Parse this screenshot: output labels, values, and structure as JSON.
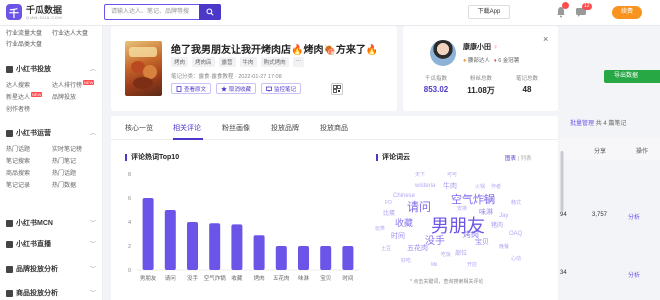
{
  "app": {
    "logo_char": "千",
    "name": "千瓜数据",
    "sub": "QIAN-GUA.COM"
  },
  "search": {
    "placeholder": "请输入达人、笔记、品牌等搜"
  },
  "header": {
    "download_app": "下载App",
    "message_count": "12",
    "renew": "续费"
  },
  "sidebar": {
    "quick_links": [
      "行业流量大盘",
      "行业达人大盘",
      "行业品类大盘"
    ],
    "sections": [
      {
        "title": "小红书投放",
        "items": [
          "达人搜索",
          "达人排行榜",
          "新星达人",
          "品牌投放",
          "创作者榜"
        ]
      },
      {
        "title": "小红书运营",
        "items": [
          "热门话题",
          "实时笔记榜",
          "笔记搜索",
          "热门笔记",
          "商品搜索",
          "热门话题",
          "笔记记录",
          "热门数据"
        ]
      },
      {
        "title": "小红书MCN"
      },
      {
        "title": "小红书直播"
      },
      {
        "title": "品牌投放分析"
      },
      {
        "title": "商品投放分析"
      }
    ],
    "badge_new": "NEW"
  },
  "background": {
    "green_button": "导出数据",
    "links_prefix": "批量管理",
    "links_suffix": "共 4 篇笔记",
    "table_headers": [
      "分享",
      "操作"
    ],
    "rows": [
      {
        "share": "3,757",
        "action": "分析"
      },
      {
        "share": "",
        "action": "分析"
      }
    ],
    "left_values": [
      "94",
      "34"
    ]
  },
  "note": {
    "title": "绝了我男朋友让我开烤肉店🔥烤肉🍖方来了🔥",
    "tags": [
      "烤肉",
      "烤肉店",
      "露营",
      "牛肉",
      "购式烤肉",
      "···"
    ],
    "time": "笔记分类：露食·露食教程 · 2022-01-27 17:08",
    "actions": [
      "查看原文",
      "取消收藏",
      "监控笔记"
    ]
  },
  "author": {
    "name": "康康小田",
    "gender_icon": "♀",
    "badges": [
      "腰部达人",
      "6 金冠薯"
    ],
    "stats": [
      {
        "label": "千瓜指数",
        "value": "853.02",
        "color": "#4b38c9"
      },
      {
        "label": "粉丝总数",
        "value": "11.08万",
        "color": "#222222"
      },
      {
        "label": "笔记总数",
        "value": "48",
        "color": "#222222"
      }
    ]
  },
  "tabs": [
    "核心一览",
    "相关评论",
    "粉丝画像",
    "投放品牌",
    "投放商品"
  ],
  "active_tab": 1,
  "chart_section_title": "评论热词Top10",
  "chart_data": {
    "type": "bar",
    "categories": [
      "男朋友",
      "请问",
      "没手",
      "空气炸锅",
      "收藏",
      "烤肉",
      "五花肉",
      "味淋",
      "宝贝",
      "时间"
    ],
    "values": [
      6.0,
      5.0,
      4.0,
      3.9,
      3.8,
      2.9,
      2.0,
      2.0,
      2.0,
      2.0
    ],
    "ylim": [
      0,
      6
    ],
    "yticks": [
      0,
      2,
      4,
      6,
      8
    ],
    "color": "#6a55e8"
  },
  "cloud": {
    "title": "评论词云",
    "toggle": [
      "图表",
      "列表"
    ],
    "note": "* 点击关键词，查询搜索相关评论",
    "words": [
      {
        "t": "男朋友",
        "c": "#6a55e8"
      },
      {
        "t": "请问",
        "c": "#7e6bec"
      },
      {
        "t": "空气炸锅",
        "c": "#7e6bec"
      },
      {
        "t": "没手",
        "c": "#8878ef"
      },
      {
        "t": "收藏",
        "c": "#8878ef"
      },
      {
        "t": "烤肉",
        "c": "#8878ef"
      },
      {
        "t": "五花肉",
        "c": "#9a8cf0"
      },
      {
        "t": "味淋",
        "c": "#9a8cf0"
      },
      {
        "t": "宝贝",
        "c": "#9a8cf0"
      },
      {
        "t": "时间",
        "c": "#9a8cf0"
      },
      {
        "t": "牛肉",
        "c": "#a99df2"
      },
      {
        "t": "猪肉",
        "c": "#a99df2"
      },
      {
        "t": "部位",
        "c": "#a99df2"
      },
      {
        "t": "比蛋",
        "c": "#a99df2"
      },
      {
        "t": "谢谢",
        "c": "#a99df2"
      },
      {
        "t": "Chinese",
        "c": "#b3a8f4"
      },
      {
        "t": "wisteria",
        "c": "#b3a8f4"
      },
      {
        "t": "Jay",
        "c": "#b3a8f4"
      },
      {
        "t": "OAQ",
        "c": "#b3a8f4"
      },
      {
        "t": "可可",
        "c": "#b3a8f4"
      },
      {
        "t": "天下",
        "c": "#b3a8f4"
      },
      {
        "t": "作者",
        "c": "#b3a8f4"
      },
      {
        "t": "Mii",
        "c": "#b3a8f4"
      },
      {
        "t": "开店",
        "c": "#b3a8f4"
      },
      {
        "t": "土豆",
        "c": "#b3a8f4"
      },
      {
        "t": "晚餐",
        "c": "#b3a8f4"
      },
      {
        "t": "好吃",
        "c": "#b3a8f4"
      },
      {
        "t": "玩笑",
        "c": "#b3a8f4"
      },
      {
        "t": "韩式",
        "c": "#b3a8f4"
      },
      {
        "t": "FO",
        "c": "#b3a8f4"
      },
      {
        "t": "火锅",
        "c": "#b3a8f4"
      },
      {
        "t": "吃饭",
        "c": "#b3a8f4"
      },
      {
        "t": "心动",
        "c": "#b3a8f4"
      },
      {
        "t": "安排",
        "c": "#b3a8f4"
      }
    ]
  }
}
